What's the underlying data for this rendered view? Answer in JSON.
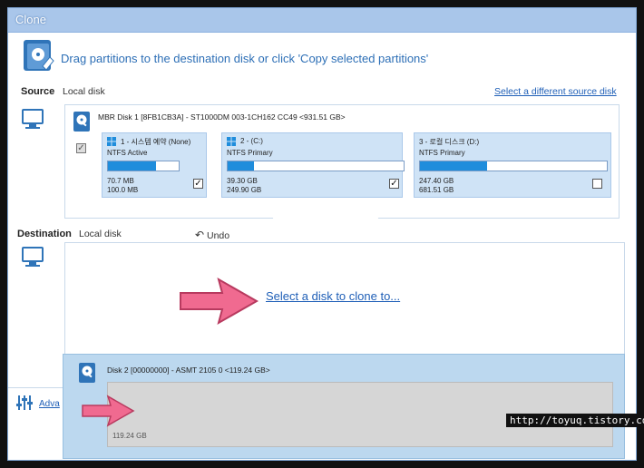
{
  "window": {
    "title": "Clone"
  },
  "header": {
    "hint": "Drag partitions to the destination disk or click 'Copy selected partitions'"
  },
  "source": {
    "label": "Source",
    "sublabel": "Local disk",
    "change_link": "Select a different source disk",
    "disk": {
      "title": "MBR Disk 1 [8FB1CB3A] - ST1000DM 003-1CH162          CC49  <931.51 GB>",
      "partitions": [
        {
          "name": "1 - 시스템 예약 (None)",
          "type": "NTFS Active",
          "used": "70.7 MB",
          "total": "100.0 MB",
          "fill": 0.68,
          "checked": true
        },
        {
          "name": "2 - (C:)",
          "type": "NTFS Primary",
          "used": "39.30 GB",
          "total": "249.90 GB",
          "fill": 0.15,
          "checked": true
        },
        {
          "name": "3 - 로컬 디스크 (D:)",
          "type": "NTFS Primary",
          "used": "247.40 GB",
          "total": "681.51 GB",
          "fill": 0.36,
          "checked": false
        }
      ]
    }
  },
  "destination": {
    "label": "Destination",
    "sublabel": "Local disk",
    "undo": "Undo",
    "select_link": "Select a disk to clone to...",
    "disk2": {
      "title": "Disk 2 [00000000] - ASMT       2105          0  <119.24 GB>",
      "size": "119.24 GB"
    }
  },
  "footer": {
    "advanced": "Adva"
  },
  "watermark": "http://toyuq.tistory.com",
  "colors": {
    "accent": "#1f5fb7",
    "partition_fill": "#1f8ddc",
    "arrow": "#e8557a"
  }
}
